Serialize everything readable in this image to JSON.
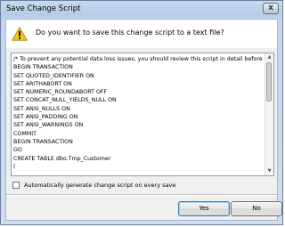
{
  "dialog": {
    "title": "Save Change Script",
    "close_glyph": "x",
    "question": "Do you want to save this change script to a text file?",
    "icon": "warning-icon"
  },
  "script": {
    "lines": [
      "/* To prevent any potential data loss issues, you should review this script in detail before r",
      "BEGIN TRANSACTION",
      "SET QUOTED_IDENTIFIER ON",
      "SET ARITHABORT ON",
      "SET NUMERIC_ROUNDABORT OFF",
      "SET CONCAT_NULL_YIELDS_NULL ON",
      "SET ANSI_NULLS ON",
      "SET ANSI_PADDING ON",
      "SET ANSI_WARNINGS ON",
      "COMMIT",
      "BEGIN TRANSACTION",
      "GO",
      "CREATE TABLE dbo.Tmp_Customer",
      "("
    ]
  },
  "options": {
    "auto_generate_label": "Automatically generate change script on every save",
    "auto_generate_checked": false
  },
  "buttons": {
    "yes_label": "Yes",
    "no_label": "No"
  },
  "colors": {
    "warning_yellow": "#f2c81e",
    "default_button_border": "#3c7fb1"
  }
}
